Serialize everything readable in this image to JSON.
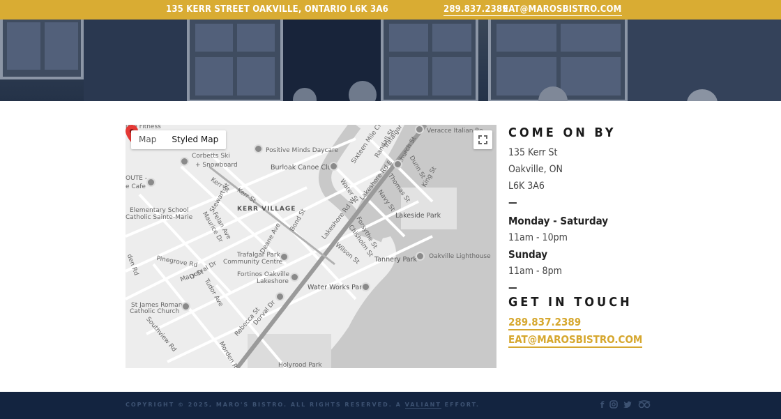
{
  "topbar": {
    "address": "135 KERR STREET OAKVILLE, ONTARIO L6K 3A6",
    "phone": "289.837.2389",
    "email": "EAT@MAROSBISTRO.COM"
  },
  "map": {
    "toggle": {
      "map": "Map",
      "styled": "Styled Map"
    },
    "labels": {
      "fitness": "ime Fitness",
      "veracce": "Veracce Italian Re",
      "positive": "Positive Minds Daycare",
      "corbetts1": "Corbetts Ski",
      "corbetts2": "+ Snowboard",
      "burloak": "Burloak Canoe Club",
      "route1": "OUTE -",
      "route2": "e Cafe",
      "kerr_village": "KERR VILLAGE",
      "elementary1": "Elementary School",
      "elementary2": "Catholic Sainte-Marie",
      "lakeside": "Lakeside Park",
      "trafalgar1": "Trafalgar Park",
      "trafalgar2": "Community Centre",
      "lighthouse": "Oakville Lighthouse",
      "tannery": "Tannery Park",
      "fortinos1": "Fortinos Oakville",
      "fortinos2": "Lakeshore",
      "waterworks": "Water Works Park",
      "stjames1": "St James Roman",
      "stjames2": "Catholic Church",
      "holyrood": "Holyrood Park",
      "kerr_st": "Kerr St",
      "lakeshore_rd": "Lakeshore Rd W",
      "lakeshore_e": "Lakeshore Rd E",
      "sixteen": "Sixteen Mile Cr",
      "trafalgar_rd": "Trafalgar Rd",
      "dorval": "Dorval Dr",
      "rebecca": "Rebecca St",
      "pinegrove": "Pinegrove Rd",
      "mary": "Mary St",
      "stewart": "Stewart St",
      "deane": "Deane Ave",
      "bond": "Bond St",
      "felan": "Felan Ave",
      "maurice": "Maurice Dr",
      "water": "Water St",
      "navy": "Navy St",
      "thomas": "Thomas St",
      "randall": "Randall St",
      "church": "Church St",
      "dunn": "Dunn St",
      "king": "King St",
      "forsythe": "Forsythe St",
      "chisholm": "Chisholm St",
      "wilson": "Wilson St",
      "tudor": "Tudor Ave",
      "southview": "Southview Rd",
      "morden": "Morden Rd",
      "linden": "den Rd",
      "kerr_st_2": "Kerr St"
    }
  },
  "info": {
    "come_heading": "COME ON BY",
    "street": "135 Kerr St",
    "city": "Oakville, ON",
    "postal": "L6K 3A6",
    "dash": "—",
    "day1": "Monday - Saturday",
    "hours1": "11am - 10pm",
    "day2": "Sunday",
    "hours2": "11am - 8pm",
    "touch_heading": "GET IN TOUCH",
    "phone": "289.837.2389",
    "email": "EAT@MAROSBISTRO.COM"
  },
  "footer": {
    "copyright": "COPYRIGHT © 2025, MARO'S BISTRO. ALL RIGHTS RESERVED. A",
    "valiant": "VALIANT",
    "effort": "EFFORT.",
    "icons": [
      "facebook-icon",
      "instagram-icon",
      "twitter-icon",
      "tripadvisor-icon"
    ]
  },
  "colors": {
    "gold": "#d9ac33",
    "navy": "#132440",
    "pin": "#e53935"
  }
}
